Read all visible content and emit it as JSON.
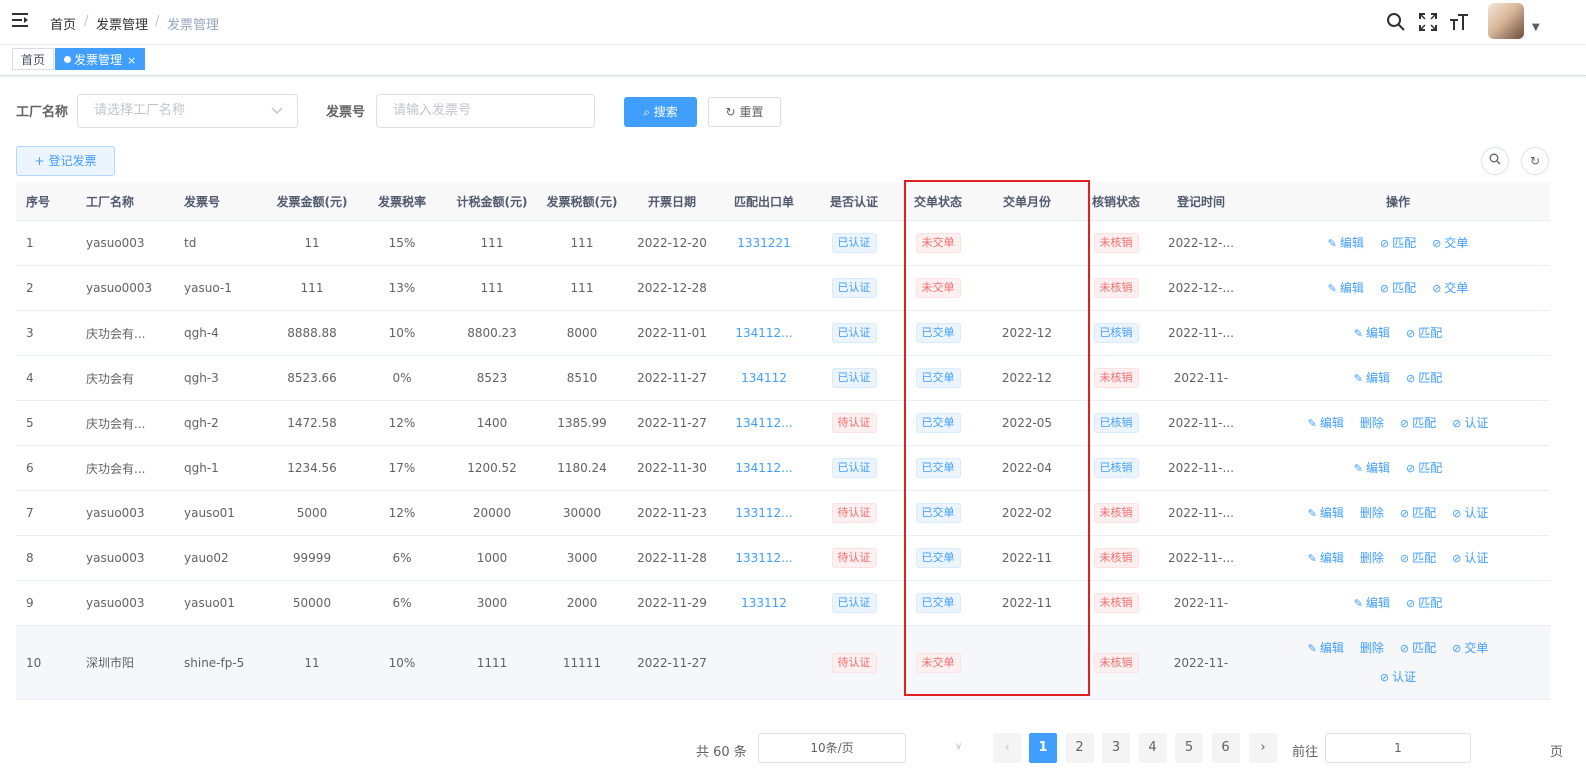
{
  "breadcrumb": [
    "首页",
    "发票管理",
    "发票管理"
  ],
  "tags": [
    {
      "label": "首页"
    },
    {
      "label": "发票管理",
      "close": "×"
    }
  ],
  "form": {
    "factory_label": "工厂名称",
    "factory_placeholder": "请选择工厂名称",
    "invoice_label": "发票号",
    "invoice_placeholder": "请输入发票号",
    "search_label": "搜索",
    "reset_label": "重置",
    "register_label": "登记发票"
  },
  "table": {
    "headers": [
      "序号",
      "工厂名称",
      "发票号",
      "发票金额(元)",
      "发票税率",
      "计税金额(元)",
      "发票税额(元)",
      "开票日期",
      "匹配出口单",
      "是否认证",
      "交单状态",
      "交单月份",
      "核销状态",
      "登记时间",
      "操作"
    ],
    "rows": [
      {
        "no": "1",
        "factory": "yasuo003",
        "invoice": "td",
        "amount": "11",
        "rate": "15%",
        "taxable": "111",
        "tax": "111",
        "date": "2022-12-20",
        "export": "1331221",
        "auth": "已认证",
        "submit": "未交单",
        "month": "",
        "verify": "未核销",
        "reg": "2022-12-...",
        "ops": [
          "编辑",
          "匹配",
          "交单"
        ]
      },
      {
        "no": "2",
        "factory": "yasuo0003",
        "invoice": "yasuo-1",
        "amount": "111",
        "rate": "13%",
        "taxable": "111",
        "tax": "111",
        "date": "2022-12-28",
        "export": "",
        "auth": "已认证",
        "submit": "未交单",
        "month": "",
        "verify": "未核销",
        "reg": "2022-12-...",
        "ops": [
          "编辑",
          "匹配",
          "交单"
        ]
      },
      {
        "no": "3",
        "factory": "庆功会有...",
        "invoice": "qgh-4",
        "amount": "8888.88",
        "rate": "10%",
        "taxable": "8800.23",
        "tax": "8000",
        "date": "2022-11-01",
        "export": "134112...",
        "auth": "已认证",
        "submit": "已交单",
        "month": "2022-12",
        "verify": "已核销",
        "reg": "2022-11-...",
        "ops": [
          "编辑",
          "匹配"
        ]
      },
      {
        "no": "4",
        "factory": "庆功会有",
        "invoice": "qgh-3",
        "amount": "8523.66",
        "rate": "0%",
        "taxable": "8523",
        "tax": "8510",
        "date": "2022-11-27",
        "export": "134112",
        "auth": "已认证",
        "submit": "已交单",
        "month": "2022-12",
        "verify": "未核销",
        "reg": "2022-11-",
        "ops": [
          "编辑",
          "匹配"
        ]
      },
      {
        "no": "5",
        "factory": "庆功会有...",
        "invoice": "qgh-2",
        "amount": "1472.58",
        "rate": "12%",
        "taxable": "1400",
        "tax": "1385.99",
        "date": "2022-11-27",
        "export": "134112...",
        "auth": "待认证",
        "submit": "已交单",
        "month": "2022-05",
        "verify": "已核销",
        "reg": "2022-11-...",
        "ops": [
          "编辑",
          "删除",
          "匹配",
          "认证"
        ]
      },
      {
        "no": "6",
        "factory": "庆功会有...",
        "invoice": "qgh-1",
        "amount": "1234.56",
        "rate": "17%",
        "taxable": "1200.52",
        "tax": "1180.24",
        "date": "2022-11-30",
        "export": "134112...",
        "auth": "已认证",
        "submit": "已交单",
        "month": "2022-04",
        "verify": "已核销",
        "reg": "2022-11-...",
        "ops": [
          "编辑",
          "匹配"
        ]
      },
      {
        "no": "7",
        "factory": "yasuo003",
        "invoice": "yauso01",
        "amount": "5000",
        "rate": "12%",
        "taxable": "20000",
        "tax": "30000",
        "date": "2022-11-23",
        "export": "133112...",
        "auth": "待认证",
        "submit": "已交单",
        "month": "2022-02",
        "verify": "未核销",
        "reg": "2022-11-...",
        "ops": [
          "编辑",
          "删除",
          "匹配",
          "认证"
        ]
      },
      {
        "no": "8",
        "factory": "yasuo003",
        "invoice": "yauo02",
        "amount": "99999",
        "rate": "6%",
        "taxable": "1000",
        "tax": "3000",
        "date": "2022-11-28",
        "export": "133112...",
        "auth": "待认证",
        "submit": "已交单",
        "month": "2022-11",
        "verify": "未核销",
        "reg": "2022-11-...",
        "ops": [
          "编辑",
          "删除",
          "匹配",
          "认证"
        ]
      },
      {
        "no": "9",
        "factory": "yasuo003",
        "invoice": "yasuo01",
        "amount": "50000",
        "rate": "6%",
        "taxable": "3000",
        "tax": "2000",
        "date": "2022-11-29",
        "export": "133112",
        "auth": "已认证",
        "submit": "已交单",
        "month": "2022-11",
        "verify": "未核销",
        "reg": "2022-11-",
        "ops": [
          "编辑",
          "匹配"
        ]
      },
      {
        "no": "10",
        "factory": "深圳市阳",
        "invoice": "shine-fp-5",
        "amount": "11",
        "rate": "10%",
        "taxable": "1111",
        "tax": "11111",
        "date": "2022-11-27",
        "export": "",
        "auth": "待认证",
        "submit": "未交单",
        "month": "",
        "verify": "未核销",
        "reg": "2022-11-",
        "ops": [
          "编辑",
          "删除",
          "匹配",
          "交单",
          "认证"
        ]
      }
    ]
  },
  "pagination": {
    "total": "共 60 条",
    "page_size": "10条/页",
    "pages": [
      "1",
      "2",
      "3",
      "4",
      "5",
      "6"
    ],
    "current": "1",
    "goto_label": "前往",
    "goto_value": "1",
    "page_suffix": "页"
  },
  "colors": {
    "primary": "#409eff",
    "danger": "#f56c6c",
    "highlight": "#e0201f"
  },
  "icons": {
    "menu": "hamburger-icon",
    "search": "search-icon",
    "fullscreen": "fullscreen-icon",
    "font_size": "font-size-icon",
    "edit": "edit-icon",
    "check": "check-circle-icon",
    "refresh": "refresh-icon"
  }
}
